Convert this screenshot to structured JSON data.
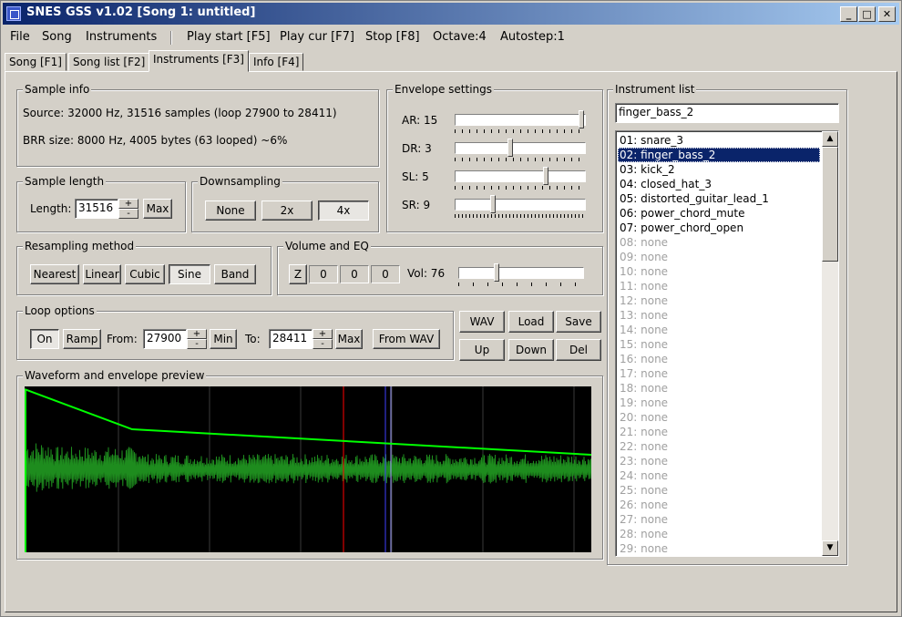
{
  "window": {
    "title": "SNES GSS v1.02 [Song 1: untitled]",
    "min_label": "_",
    "max_label": "□",
    "close_label": "✕"
  },
  "menu": {
    "file": "File",
    "song": "Song",
    "instruments": "Instruments",
    "play_start": "Play start [F5]",
    "play_cur": "Play cur [F7]",
    "stop": "Stop [F8]",
    "octave": "Octave:4",
    "autostep": "Autostep:1"
  },
  "tabs": [
    {
      "label": "Song [F1]"
    },
    {
      "label": "Song list [F2]"
    },
    {
      "label": "Instruments [F3]"
    },
    {
      "label": "Info [F4]"
    }
  ],
  "sample_info": {
    "title": "Sample info",
    "source": "Source: 32000 Hz, 31516 samples (loop 27900 to 28411)",
    "brr": "BRR size: 8000 Hz, 4005 bytes (63 looped) ~6%"
  },
  "sample_length": {
    "title": "Sample length",
    "label": "Length:",
    "value": "31516",
    "max_label": "Max"
  },
  "downsampling": {
    "title": "Downsampling",
    "options": [
      "None",
      "2x",
      "4x"
    ],
    "selected": "4x"
  },
  "envelope": {
    "title": "Envelope settings",
    "ar_label": "AR: 15",
    "dr_label": "DR: 3",
    "sl_label": "SL: 5",
    "sr_label": "SR: 9",
    "ar_level": 1.0,
    "dr_level": 0.43,
    "sl_level": 0.71,
    "sr_level": 0.29
  },
  "resampling": {
    "title": "Resampling method",
    "options": [
      "Nearest",
      "Linear",
      "Cubic",
      "Sine",
      "Band"
    ],
    "selected": "Sine"
  },
  "volume_eq": {
    "title": "Volume and EQ",
    "z_label": "Z",
    "eq": [
      "0",
      "0",
      "0"
    ],
    "vol_label": "Vol: 76",
    "vol_level": 0.3
  },
  "loop": {
    "title": "Loop options",
    "on_label": "On",
    "ramp_label": "Ramp",
    "from_label": "From:",
    "from_value": "27900",
    "min_label": "Min",
    "to_label": "To:",
    "to_value": "28411",
    "max_label": "Max",
    "from_wav_label": "From WAV"
  },
  "actions": {
    "wav": "WAV",
    "load": "Load",
    "save": "Save",
    "up": "Up",
    "down": "Down",
    "del": "Del"
  },
  "preview": {
    "title": "Waveform and envelope preview",
    "wave_color": "#1e8c1e",
    "envelope_color": "#00ff00",
    "loop_start_color": "#ff0000",
    "loop_end_color": "#0000ff"
  },
  "instrument_list": {
    "title": "Instrument list",
    "name_value": "finger_bass_2",
    "selected_index": 1,
    "items": [
      {
        "label": "01: snare_3",
        "empty": false
      },
      {
        "label": "02: finger_bass_2",
        "empty": false
      },
      {
        "label": "03: kick_2",
        "empty": false
      },
      {
        "label": "04: closed_hat_3",
        "empty": false
      },
      {
        "label": "05: distorted_guitar_lead_1",
        "empty": false
      },
      {
        "label": "06: power_chord_mute",
        "empty": false
      },
      {
        "label": "07: power_chord_open",
        "empty": false
      },
      {
        "label": "08: none",
        "empty": true
      },
      {
        "label": "09: none",
        "empty": true
      },
      {
        "label": "10: none",
        "empty": true
      },
      {
        "label": "11: none",
        "empty": true
      },
      {
        "label": "12: none",
        "empty": true
      },
      {
        "label": "13: none",
        "empty": true
      },
      {
        "label": "14: none",
        "empty": true
      },
      {
        "label": "15: none",
        "empty": true
      },
      {
        "label": "16: none",
        "empty": true
      },
      {
        "label": "17: none",
        "empty": true
      },
      {
        "label": "18: none",
        "empty": true
      },
      {
        "label": "19: none",
        "empty": true
      },
      {
        "label": "20: none",
        "empty": true
      },
      {
        "label": "21: none",
        "empty": true
      },
      {
        "label": "22: none",
        "empty": true
      },
      {
        "label": "23: none",
        "empty": true
      },
      {
        "label": "24: none",
        "empty": true
      },
      {
        "label": "25: none",
        "empty": true
      },
      {
        "label": "26: none",
        "empty": true
      },
      {
        "label": "27: none",
        "empty": true
      },
      {
        "label": "28: none",
        "empty": true
      },
      {
        "label": "29: none",
        "empty": true
      }
    ]
  }
}
